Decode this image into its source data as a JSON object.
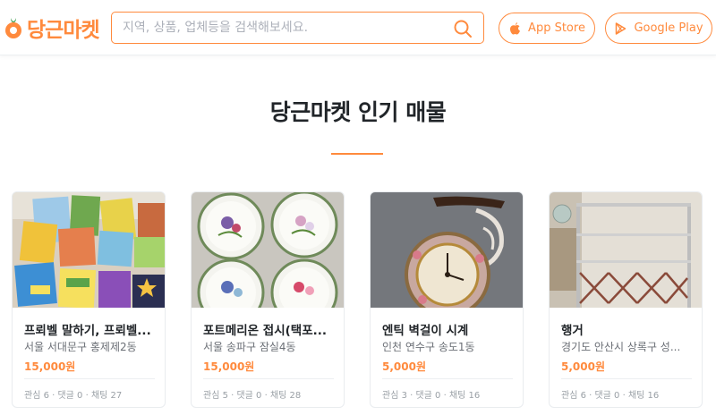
{
  "header": {
    "logo_text": "당근마켓",
    "search": {
      "placeholder": "지역, 상품, 업체등을 검색해보세요.",
      "value": ""
    },
    "app_store_label": "App Store",
    "google_play_label": "Google Play"
  },
  "colors": {
    "brand": "#ff8a3d",
    "text": "#212529",
    "muted": "#6b6f76"
  },
  "main": {
    "title": "당근마켓 인기 매물",
    "cards": [
      {
        "title": "프뢰벨 말하기, 프뢰벨...",
        "region": "서울 서대문구 홍제제2동",
        "price": "15,000원",
        "counts": "관심 6 · 댓글 0 · 채팅 27"
      },
      {
        "title": "포트메리온 접시(택포...",
        "region": "서울 송파구 잠실4동",
        "price": "15,000원",
        "counts": "관심 5 · 댓글 0 · 채팅 28"
      },
      {
        "title": "엔틱 벽걸이 시계",
        "region": "인천 연수구 송도1동",
        "price": "5,000원",
        "counts": "관심 3 · 댓글 0 · 채팅 16"
      },
      {
        "title": "행거",
        "region": "경기도 안산시 상록구 성...",
        "price": "5,000원",
        "counts": "관심 6 · 댓글 0 · 채팅 16"
      }
    ]
  }
}
